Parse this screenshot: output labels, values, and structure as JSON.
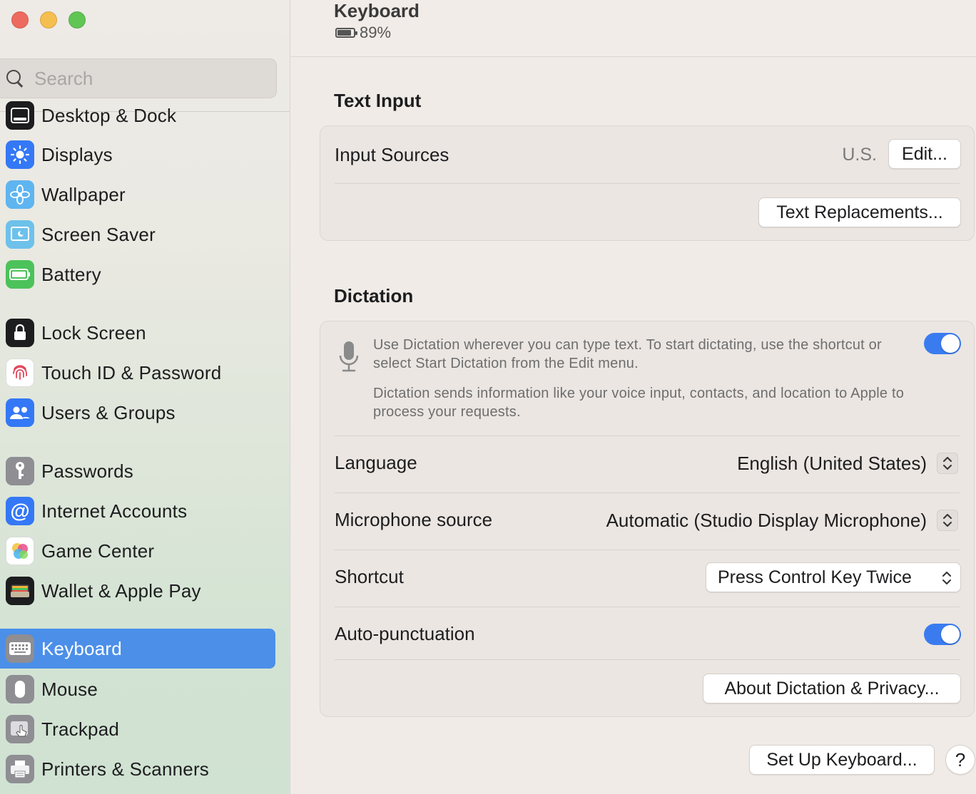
{
  "window": {
    "traffic_lights": [
      "close",
      "minimize",
      "zoom"
    ]
  },
  "sidebar": {
    "search_placeholder": "Search",
    "items": [
      {
        "label": "Desktop & Dock",
        "icon": "dock-icon",
        "color": "#1d1d1f"
      },
      {
        "label": "Displays",
        "icon": "sun-icon",
        "color": "#3478f6"
      },
      {
        "label": "Wallpaper",
        "icon": "flower-icon",
        "color": "#5fb5f0"
      },
      {
        "label": "Screen Saver",
        "icon": "screensaver-icon",
        "color": "#6dc1ea"
      },
      {
        "label": "Battery",
        "icon": "battery-icon",
        "color": "#4cc25a"
      },
      {
        "label": "Lock Screen",
        "icon": "lock-icon",
        "color": "#1d1d1f"
      },
      {
        "label": "Touch ID & Password",
        "icon": "fingerprint-icon",
        "color": "#ffffff"
      },
      {
        "label": "Users & Groups",
        "icon": "users-icon",
        "color": "#3478f6"
      },
      {
        "label": "Passwords",
        "icon": "key-icon",
        "color": "#8e8e93"
      },
      {
        "label": "Internet Accounts",
        "icon": "at-icon",
        "color": "#3478f6"
      },
      {
        "label": "Game Center",
        "icon": "game-center-icon",
        "color": "#ffffff"
      },
      {
        "label": "Wallet & Apple Pay",
        "icon": "wallet-icon",
        "color": "#1d1d1f"
      },
      {
        "label": "Keyboard",
        "icon": "keyboard-icon",
        "color": "#8e8e93",
        "active": true
      },
      {
        "label": "Mouse",
        "icon": "mouse-icon",
        "color": "#8e8e93"
      },
      {
        "label": "Trackpad",
        "icon": "trackpad-icon",
        "color": "#8e8e93"
      },
      {
        "label": "Printers & Scanners",
        "icon": "printer-icon",
        "color": "#8e8e93"
      }
    ]
  },
  "header": {
    "title": "Keyboard",
    "battery_percent": "89%"
  },
  "text_input": {
    "section_title": "Text Input",
    "input_sources_label": "Input Sources",
    "input_sources_value": "U.S.",
    "edit_button": "Edit...",
    "text_replacements_button": "Text Replacements..."
  },
  "dictation": {
    "section_title": "Dictation",
    "enabled": true,
    "description_1": "Use Dictation wherever you can type text. To start dictating, use the shortcut or select Start Dictation from the Edit menu.",
    "description_2": "Dictation sends information like your voice input, contacts, and location to Apple to process your requests.",
    "language_label": "Language",
    "language_value": "English (United States)",
    "microphone_label": "Microphone source",
    "microphone_value": "Automatic (Studio Display Microphone)",
    "shortcut_label": "Shortcut",
    "shortcut_value": "Press Control Key Twice",
    "autopunct_label": "Auto-punctuation",
    "autopunct_enabled": true,
    "about_button": "About Dictation & Privacy..."
  },
  "footer": {
    "setup_button": "Set Up Keyboard...",
    "help_label": "?"
  },
  "colors": {
    "accent": "#3a7cf0",
    "sidebar_active": "#4b8fe9"
  }
}
